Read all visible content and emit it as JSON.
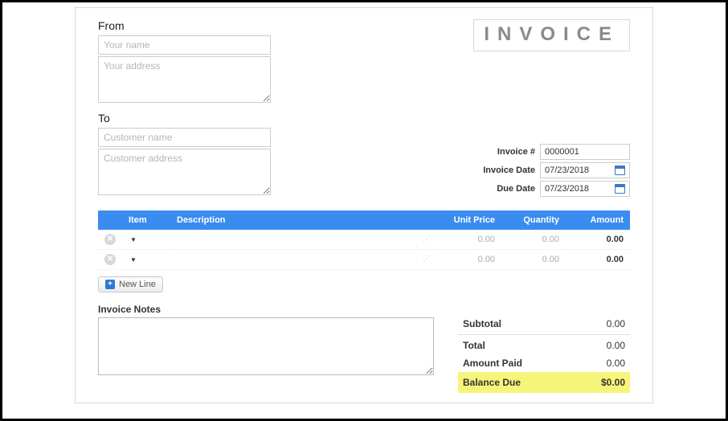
{
  "header": {
    "title": "INVOICE",
    "from_label": "From",
    "to_label": "To"
  },
  "from": {
    "name_placeholder": "Your name",
    "name_value": "",
    "address_placeholder": "Your address",
    "address_value": ""
  },
  "to": {
    "name_placeholder": "Customer name",
    "name_value": "",
    "address_placeholder": "Customer address",
    "address_value": ""
  },
  "meta": {
    "invoice_number_label": "Invoice #",
    "invoice_number_value": "0000001",
    "invoice_date_label": "Invoice Date",
    "invoice_date_value": "07/23/2018",
    "due_date_label": "Due Date",
    "due_date_value": "07/23/2018"
  },
  "items_header": {
    "item": "Item",
    "description": "Description",
    "unit_price": "Unit Price",
    "quantity": "Quantity",
    "amount": "Amount"
  },
  "items": [
    {
      "item": "",
      "description": "",
      "unit_price": "0.00",
      "quantity": "0.00",
      "amount": "0.00"
    },
    {
      "item": "",
      "description": "",
      "unit_price": "0.00",
      "quantity": "0.00",
      "amount": "0.00"
    }
  ],
  "new_line_label": "New Line",
  "notes": {
    "label": "Invoice Notes",
    "value": ""
  },
  "totals": {
    "subtotal_label": "Subtotal",
    "subtotal_value": "0.00",
    "total_label": "Total",
    "total_value": "0.00",
    "amount_paid_label": "Amount Paid",
    "amount_paid_value": "0.00",
    "balance_due_label": "Balance Due",
    "balance_due_value": "$0.00"
  }
}
